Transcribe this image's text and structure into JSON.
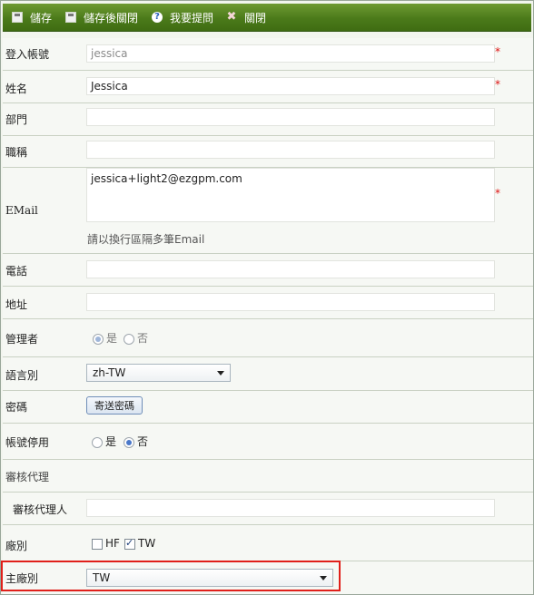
{
  "toolbar": {
    "save": "儲存",
    "save_close": "儲存後關閉",
    "help": "我要提問",
    "close": "關閉"
  },
  "form": {
    "login_label": "登入帳號",
    "login_value": "jessica",
    "name_label": "姓名",
    "name_value": "Jessica",
    "dept_label": "部門",
    "dept_value": "",
    "title_label": "職稱",
    "title_value": "",
    "email_label": "EMail",
    "email_value": "jessica+light2@ezgpm.com",
    "email_hint": "請以換行區隔多筆Email",
    "phone_label": "電話",
    "phone_value": "",
    "address_label": "地址",
    "address_value": "",
    "admin_label": "管理者",
    "admin_yes": "是",
    "admin_no": "否",
    "admin_selected": "是",
    "lang_label": "語言別",
    "lang_value": "zh-TW",
    "password_label": "密碼",
    "password_button": "寄送密碼",
    "disable_label": "帳號停用",
    "disable_yes": "是",
    "disable_no": "否",
    "disable_selected": "否",
    "review_section": "審核代理",
    "reviewer_label": "審核代理人",
    "reviewer_value": "",
    "plant_label": "廠別",
    "plant_options": [
      {
        "label": "HF",
        "checked": false
      },
      {
        "label": "TW",
        "checked": true
      }
    ],
    "main_plant_label": "主廠別",
    "main_plant_value": "TW",
    "required_mark": "*"
  },
  "colors": {
    "toolbar": "#4b7a1a",
    "required": "#dd1111",
    "highlight": "#e0201a"
  }
}
